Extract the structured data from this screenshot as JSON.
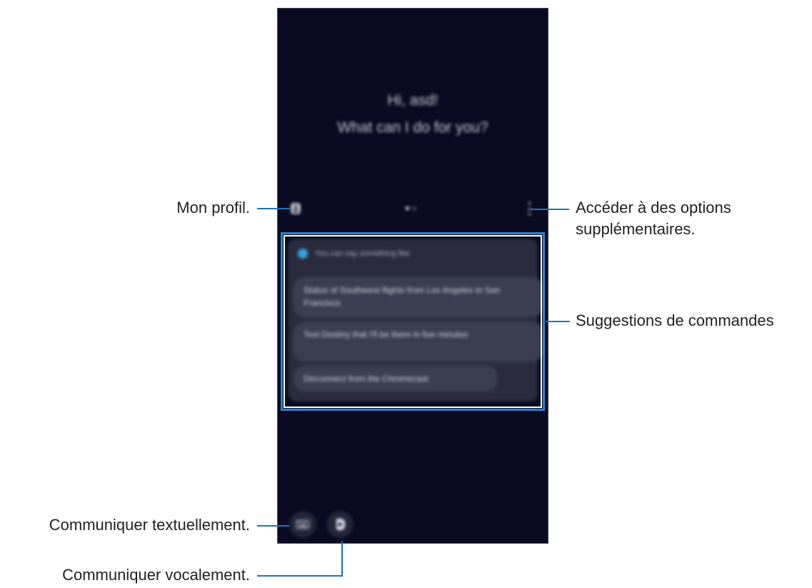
{
  "phone": {
    "greeting_line1": "Hi, asd!",
    "greeting_line2": "What can I do for you?",
    "icons": {
      "profile": "profile-icon",
      "more": "more-options-icon",
      "keyboard": "keyboard-icon",
      "microphone": "microphone-icon"
    },
    "suggestions": {
      "header": "You can say something like",
      "items": [
        "Status of Southwest flights from Los Angeles to San Francisco",
        "Text Destiny that I'll be there in five minutes",
        "Disconnect from the Chromecast"
      ]
    }
  },
  "callouts": {
    "profile": "Mon profil.",
    "more_options_line1": "Accéder à des options",
    "more_options_line2": "supplémentaires.",
    "suggestions": "Suggestions de commandes",
    "text_input": "Communiquer textuellement.",
    "voice_input": "Communiquer vocalement."
  },
  "colors": {
    "phone_background": "#0a0a22",
    "callout_line": "#1b75bc",
    "highlight_border": "#2e83c8",
    "label_text": "#231f20"
  }
}
